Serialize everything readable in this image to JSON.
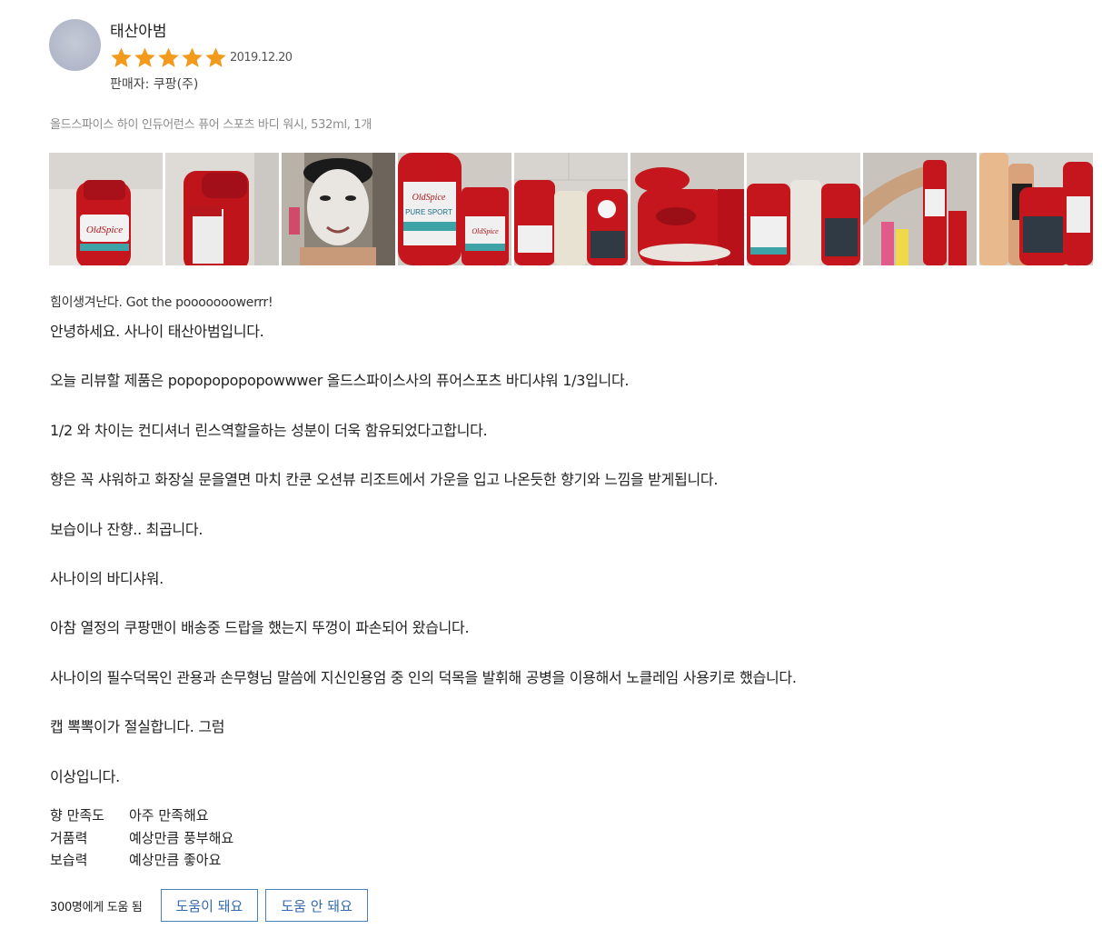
{
  "review": {
    "reviewer_name": "태산아범",
    "rating": 5,
    "rating_max": 5,
    "date": "2019.12.20",
    "seller": "판매자: 쿠팡(주)",
    "product": "올드스파이스 하이 인듀어런스 퓨어 스포츠 바디 워시, 532ml, 1개",
    "star_color": "#f29a1c",
    "photos": [
      {
        "name": "photo-1",
        "desc": "old-spice-bottle-front"
      },
      {
        "name": "photo-2",
        "desc": "old-spice-bottle-back"
      },
      {
        "name": "photo-3",
        "desc": "face-with-foam"
      },
      {
        "name": "photo-4",
        "desc": "pure-sport-bottle-and-deodorant"
      },
      {
        "name": "photo-5",
        "desc": "bottles-on-shelf"
      },
      {
        "name": "photo-6",
        "desc": "broken-cap-closeup"
      },
      {
        "name": "photo-7",
        "desc": "bottles-lined-up"
      },
      {
        "name": "photo-8",
        "desc": "arm-holding-bottle"
      },
      {
        "name": "photo-9",
        "desc": "bathroom-shelf-bottles"
      }
    ],
    "headline": "힘이생겨난다. Got the pooooooowerrr!",
    "body_lines": [
      "안녕하세요. 사나이 태산아범입니다.",
      "",
      "오늘 리뷰할 제품은 popopopopopowwwer 올드스파이스사의 퓨어스포츠 바디샤워 1/3입니다.",
      "",
      "1/2 와 차이는 컨디셔너 린스역할을하는 성분이 더욱 함유되었다고합니다.",
      "",
      "향은 꼭 샤워하고 화장실 문을열면 마치 칸쿤 오션뷰 리조트에서 가운을 입고 나온듯한 향기와 느낌을 받게됩니다.",
      "",
      "보습이나 잔향.. 최곱니다.",
      "",
      "사나이의 바디샤워.",
      "",
      "아참 열정의 쿠팡맨이 배송중 드랍을 했는지 뚜껑이 파손되어 왔습니다.",
      "",
      "사나이의 필수덕목인 관용과 손무형님 말씀에 지신인용엄 중 인의 덕목을 발휘해 공병을 이용해서 노클레임 사용키로 했습니다.",
      "",
      "캡 뽁뽁이가 절실합니다. 그럼",
      "",
      "이상입니다."
    ],
    "survey": [
      {
        "key": "향 만족도",
        "value": "아주 만족해요"
      },
      {
        "key": "거품력",
        "value": "예상만큼 풍부해요"
      },
      {
        "key": "보습력",
        "value": "예상만큼 좋아요"
      }
    ],
    "help_count": "300명에게 도움 됨",
    "helpful_button": "도움이 돼요",
    "not_helpful_button": "도움 안 돼요",
    "button_color": "#346aaf"
  }
}
